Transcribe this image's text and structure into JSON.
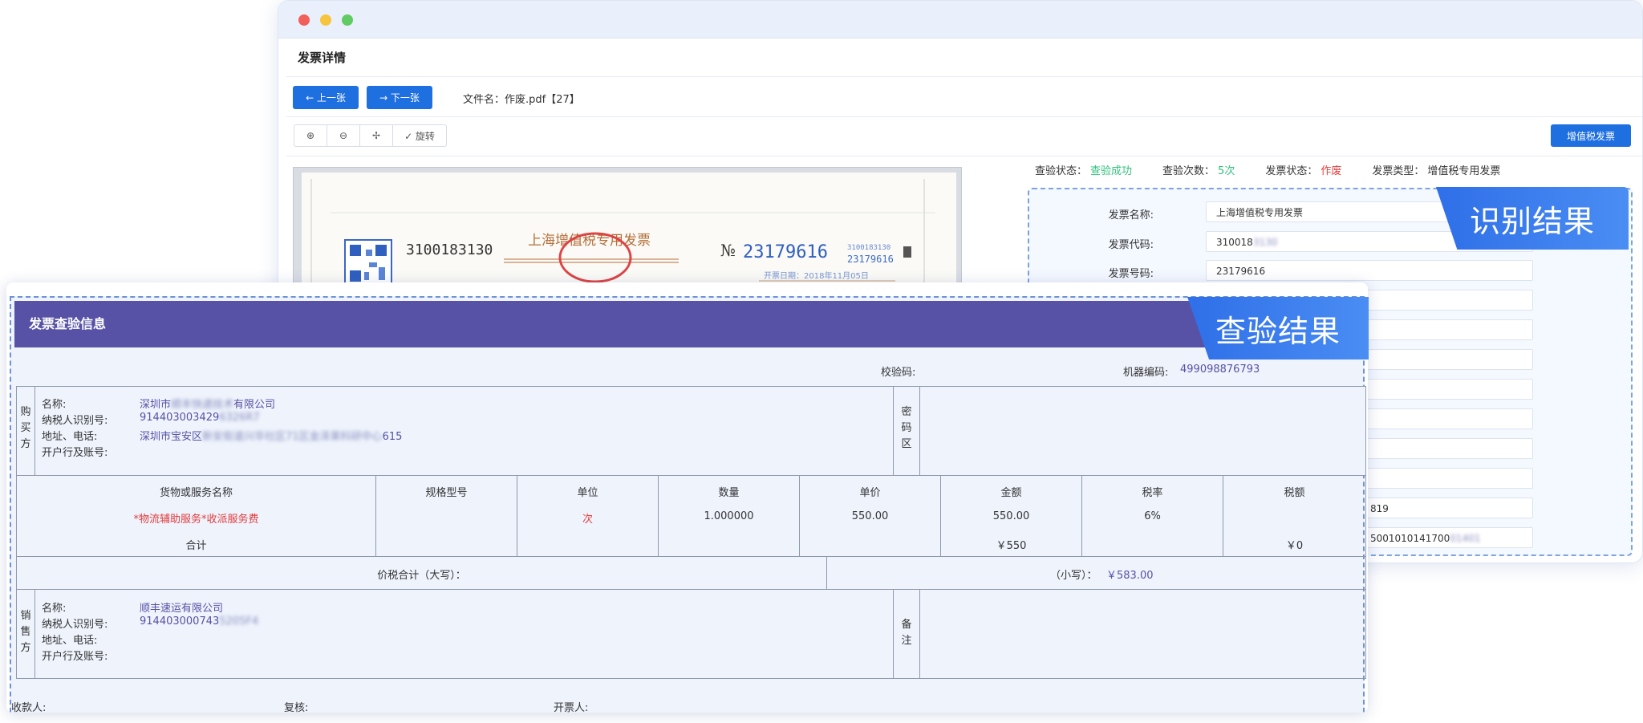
{
  "window": {
    "title": "发票详情",
    "prev_label": "← 上一张",
    "next_label": "→ 下一张",
    "file_label": "文件名：作废.pdf【27】",
    "tools": [
      "⊕",
      "⊖",
      "✢",
      "✓ 旋转"
    ],
    "vat_button": "增值税发票"
  },
  "scan": {
    "code": "3100183130",
    "title": "上海增值税专用发票",
    "no_prefix": "№",
    "number": "23179616",
    "small_code": "3100183130",
    "small_number": "23179616",
    "date": "开票日期：2018年11月05日"
  },
  "status": {
    "check_state_label": "查验状态：",
    "check_state_value": "查验成功",
    "check_count_label": "查验次数：",
    "check_count_value": "5次",
    "invoice_state_label": "发票状态：",
    "invoice_state_value": "作废",
    "invoice_type_label": "发票类型：",
    "invoice_type_value": "增值税专用发票"
  },
  "ocr": {
    "ribbon": "识别结果",
    "fields": [
      {
        "label": "发票名称:",
        "value": "上海增值税专用发票"
      },
      {
        "label": "发票代码:",
        "value": "310018",
        "hidden": "3130"
      },
      {
        "label": "发票号码:",
        "value": "23179616"
      },
      {
        "label": "",
        "value": ""
      },
      {
        "label": "",
        "value": ""
      },
      {
        "label": "",
        "value": ""
      },
      {
        "label": "",
        "value": ""
      },
      {
        "label": "",
        "value": ""
      },
      {
        "label": "",
        "value": ""
      },
      {
        "label": "",
        "value": ""
      },
      {
        "label": "",
        "value": "819"
      },
      {
        "label": "",
        "value": "5001010141700",
        "hidden": "01401"
      }
    ]
  },
  "check": {
    "title": "发票查验信息",
    "ribbon": "查验结果",
    "verify_code_label": "校验码:",
    "machine_code_label": "机器编码:",
    "machine_code_value": "499098876793",
    "buyer": {
      "side_label": [
        "购",
        "买",
        "方"
      ],
      "name_label": "名称:",
      "name_value_a": "深圳市",
      "name_value_hidden": "顺丰快递技术",
      "name_value_b": "有限公司",
      "tax_label": "纳税人识别号:",
      "tax_value": "914403003429",
      "tax_hidden": "6326R7",
      "addr_label": "地址、电话:",
      "addr_value_a": "深圳市宝安区",
      "addr_hidden": "新安街道兴华社区71区金泽莱科研中心",
      "addr_value_b": "615",
      "bank_label": "开户行及账号:"
    },
    "cipher_label": [
      "密",
      "码",
      "区"
    ],
    "table": {
      "headers": [
        "货物或服务名称",
        "规格型号",
        "单位",
        "数量",
        "单价",
        "金额",
        "税率",
        "税额"
      ],
      "row": {
        "name": "*物流辅助服务*收派服务费",
        "spec": "",
        "unit": "次",
        "qty": "1.000000",
        "price": "550.00",
        "amount": "550.00",
        "rate": "6%",
        "tax": ""
      },
      "total_label": "合计",
      "total_amount": "￥550",
      "total_tax": "￥0"
    },
    "sum_label": "价税合计（大写）：",
    "sum_small_label": "（小写）：",
    "sum_small_value": "￥583.00",
    "seller": {
      "side_label": [
        "销",
        "售",
        "方"
      ],
      "name_label": "名称:",
      "name_value": "顺丰速运有限公司",
      "tax_label": "纳税人识别号:",
      "tax_value": "914403000743",
      "tax_hidden": "5205F4",
      "addr_label": "地址、电话:",
      "bank_label": "开户行及账号:"
    },
    "remark_label": [
      "备",
      "注"
    ],
    "payee_label": "收款人:",
    "reviewer_label": "复核:",
    "drawer_label": "开票人:"
  }
}
